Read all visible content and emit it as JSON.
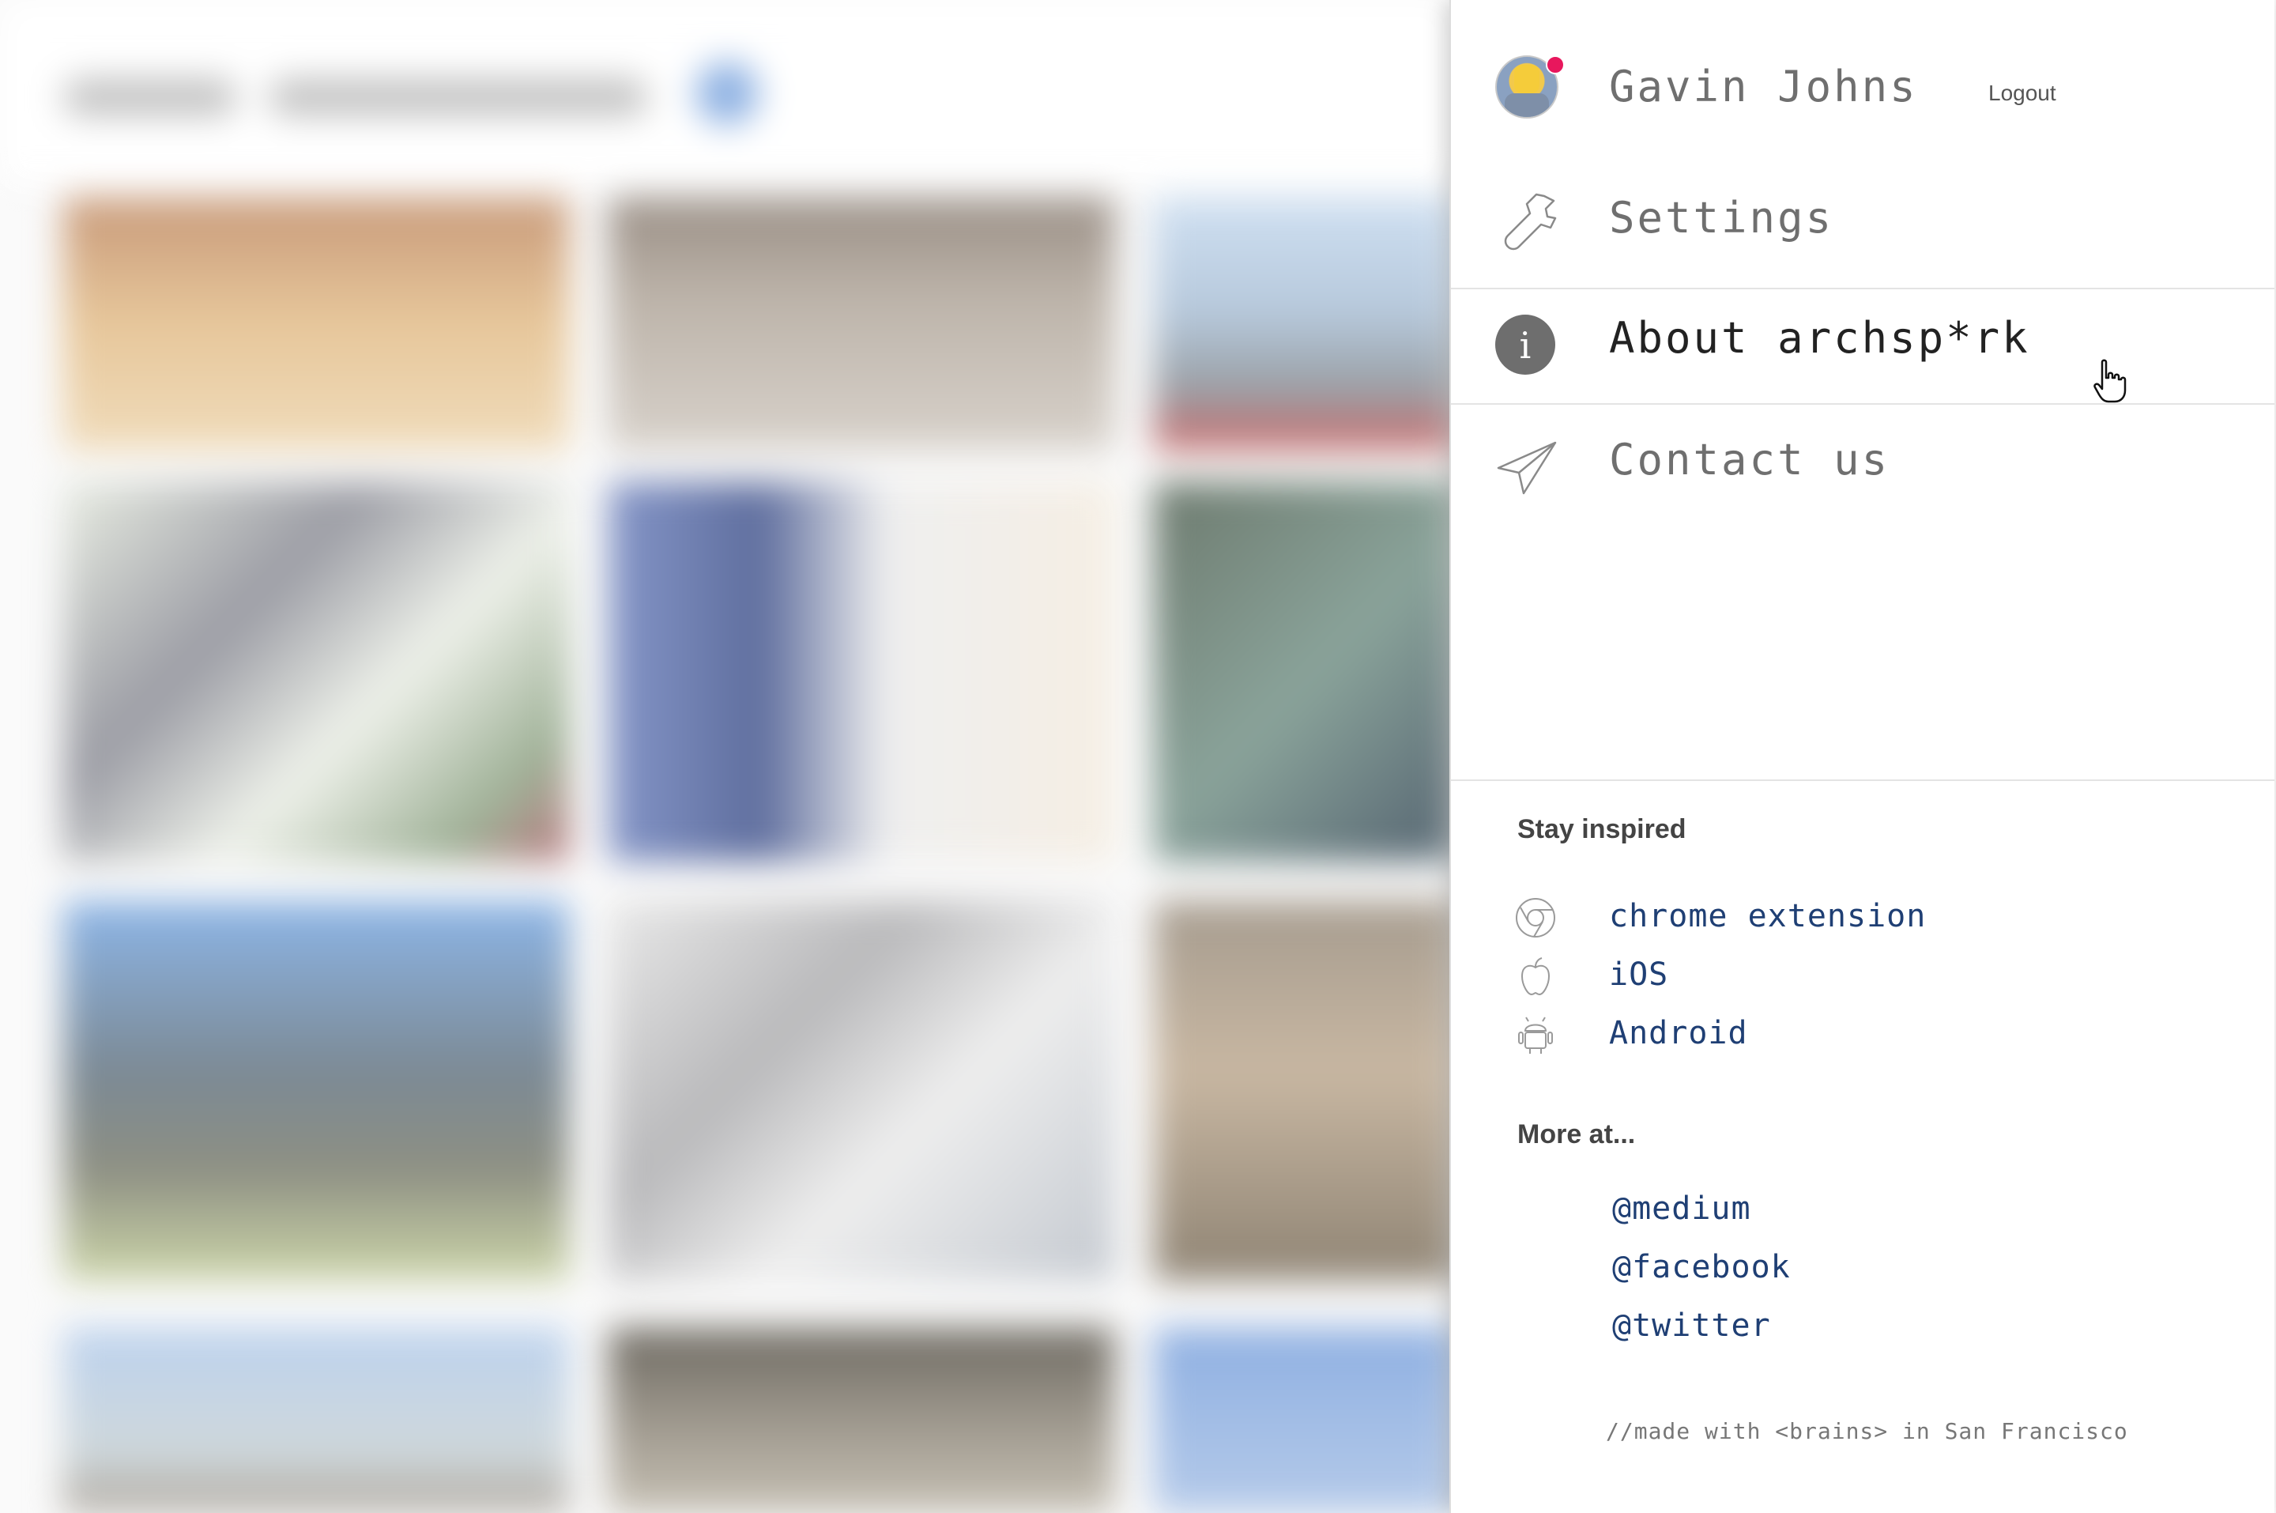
{
  "user": {
    "name": "Gavin Johns",
    "logout_label": "Logout",
    "has_notification": true
  },
  "menu": {
    "settings_label": "Settings",
    "about_label": "About archsp*rk",
    "contact_label": "Contact us"
  },
  "stay_inspired": {
    "heading": "Stay inspired",
    "apps": [
      {
        "label": "chrome extension",
        "icon": "chrome-icon"
      },
      {
        "label": "iOS",
        "icon": "apple-icon"
      },
      {
        "label": "Android",
        "icon": "android-icon"
      }
    ]
  },
  "more_at": {
    "heading": "More at...",
    "links": [
      "@medium",
      "@facebook",
      "@twitter"
    ]
  },
  "footer": "//made with <brains> in San Francisco",
  "colors": {
    "link": "#1f3f74",
    "notification": "#e8175d",
    "menu_text": "#6f6f6f",
    "active_text": "#222222"
  }
}
